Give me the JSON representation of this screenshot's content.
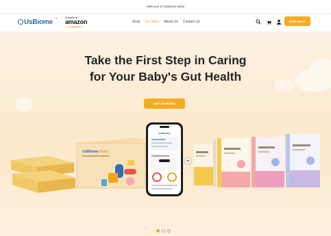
{
  "announcement": "Welcome to USBiome Bebe",
  "brand": {
    "logo_text": "UsBiome"
  },
  "amazon": {
    "available_label": "Available at",
    "wordmark": "amazon"
  },
  "nav": {
    "items": [
      {
        "label": "Shop",
        "active": false
      },
      {
        "label": "For Bebe",
        "active": true
      },
      {
        "label": "About Us",
        "active": false
      },
      {
        "label": "Contact Us",
        "active": false
      }
    ]
  },
  "header_icons": [
    "search-icon",
    "cart-icon",
    "user-icon"
  ],
  "kor_mall_label": "KOR MALL",
  "hero": {
    "headline_line1": "Take the First Step in Caring",
    "headline_line2": "for Your Baby's Gut Health",
    "cta_label": "GET STARTED"
  },
  "product_art": {
    "kit_brand": "UsBiome Bebe",
    "phone_brand": "UsBiome"
  },
  "carousel": {
    "count": 3,
    "active_index": 0
  },
  "colors": {
    "accent": "#f5ab21",
    "brand_blue": "#2b6aa8",
    "hero_bg": "#fde9cc",
    "text_dark": "#262626"
  }
}
